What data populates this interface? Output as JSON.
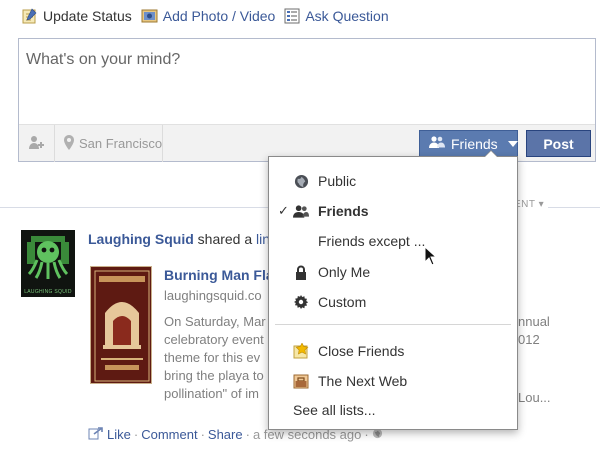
{
  "composer": {
    "tabs": [
      {
        "label": "Update Status",
        "icon": "pencil-icon"
      },
      {
        "label": "Add Photo / Video",
        "icon": "photo-icon"
      },
      {
        "label": "Ask Question",
        "icon": "question-list-icon"
      }
    ],
    "placeholder": "What's on your mind?",
    "location": "San Francisco",
    "audience_label": "Friends",
    "post_label": "Post"
  },
  "feed": {
    "sort_label": "ENT ▾"
  },
  "story": {
    "actor": "Laughing Squid",
    "verb": "shared a",
    "link_text": "link",
    "avatar_caption": "LAUGHING SQUID",
    "attachment": {
      "title": "Burning Man Fla",
      "domain": "laughingsquid.co",
      "desc_lines": [
        "On Saturday, Mar",
        "celebratory event",
        "theme for this ev",
        "bring the playa to",
        "pollination\" of im"
      ]
    },
    "right_fragments": [
      "nnual",
      "012",
      "",
      "",
      "Lou..."
    ],
    "actions": {
      "like": "Like",
      "comment": "Comment",
      "share": "Share",
      "time": "a few seconds ago"
    }
  },
  "audience_menu": {
    "items": [
      {
        "label": "Public",
        "icon": "globe-icon",
        "checked": false
      },
      {
        "label": "Friends",
        "icon": "friends-icon",
        "checked": true
      },
      {
        "label": "Friends except ...",
        "icon": "none",
        "checked": false
      },
      {
        "label": "Only Me",
        "icon": "lock-icon",
        "checked": false
      },
      {
        "label": "Custom",
        "icon": "gear-icon",
        "checked": false
      }
    ],
    "lists": [
      {
        "label": "Close Friends",
        "icon": "star-list-icon"
      },
      {
        "label": "The Next Web",
        "icon": "briefcase-list-icon"
      }
    ],
    "see_all": "See all lists..."
  },
  "colors": {
    "link": "#3b5998",
    "button_blue": "#5b74a8",
    "muted_text": "#808080"
  }
}
